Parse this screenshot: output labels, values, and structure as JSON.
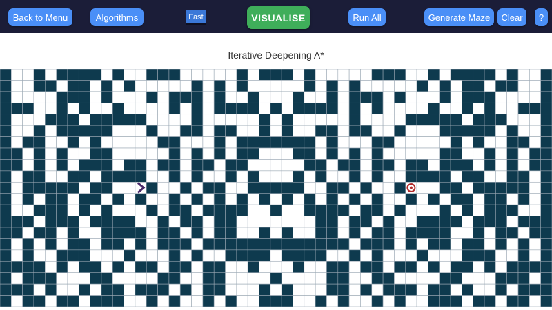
{
  "navbar": {
    "back_label": "Back to Menu",
    "algorithms_label": "Algorithms",
    "speed_label": "Fast",
    "visualise_label": "VISUALISE",
    "run_all_label": "Run All",
    "generate_maze_label": "Generate Maze",
    "clear_label": "Clear",
    "help_label": "?"
  },
  "algorithm_title": "Iterative Deepening A*",
  "grid": {
    "colors": {
      "wall": "#0e3a4e",
      "empty": "#ffffff",
      "line": "#9aa7b3",
      "start": "#4a2a6a",
      "target": "#b22a2a"
    },
    "start_icon": "chevron-right-icon",
    "target_icon": "target-icon",
    "start": {
      "row": 10,
      "col": 12
    },
    "target": {
      "row": 10,
      "col": 36
    },
    "walls": [
      "#..#.####.#..###.....#.##",
      "#..##.##.#.#.....#.#.#...",
      "#....###.#...#.###.#..#..",
      "###..#.#..#....#.#.####.#",
      "#...###.#####....#.....#.",
      "#..#.#####...#..##.##..#.",
      "#.##..#.#.....##...#.####",
      "##.#.#..##.....#.#.#.##..",
      "##.#.#.###.##.##.##.##...",
      "#.##..##.####..#.#..#.#..",
      "#.#####.##...#..#.##..###",
      "#.#.##.##.#.#..#.#.#.#.#.",
      "#..###.#.#...#.##.####..#",
      "###.###.####..#.##.##....",
      "##.##.#..####.##.#.##..#.",
      "#.#.#.##.##.#.###.#######",
      "#.#..###...#...#.#..####.",
      "####.#.##.#.##.##.##..#..",
      "#.###...##....##..##....#",
      "###.#..#.##.###.#.##...#.",
      "#.##.##.###..#.#..#.#..##"
    ]
  }
}
